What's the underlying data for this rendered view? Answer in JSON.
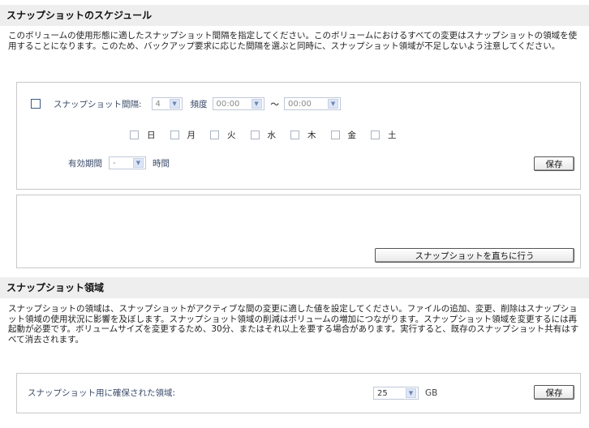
{
  "schedule": {
    "title": "スナップショットのスケジュール",
    "description": "このボリュームの使用形態に適したスナップショット間隔を指定してください。このボリュームにおけるすべての変更はスナップショットの領域を使用することになります。このため、バックアップ要求に応じた間隔を選ぶと同時に、スナップショット領域が不足しないよう注意してください。",
    "interval_label": "スナップショット間隔:",
    "interval_value": "4",
    "frequency_label": "頻度",
    "from_time": "00:00",
    "range_sep": "～",
    "to_time": "00:00",
    "days": [
      "日",
      "月",
      "火",
      "水",
      "木",
      "金",
      "土"
    ],
    "validity_label": "有効期間",
    "validity_value": "-",
    "hours_label": "時間",
    "save_label": "保存",
    "take_now_label": "スナップショットを直ちに行う"
  },
  "area": {
    "title": "スナップショット領域",
    "description": "スナップショットの領域は、スナップショットがアクティブな間の変更に適した値を設定してください。ファイルの追加、変更、削除はスナップショット領域の使用状況に影響を及ぼします。スナップショット領域の削減はボリュームの増加につながります。スナップショット領域を変更するには再起動が必要です。ボリュームサイズを変更するため、30分、またはそれ以上を要する場合があります。実行すると、既存のスナップショット共有はすべて消去されます。",
    "reserved_label": "スナップショット用に確保された領域:",
    "reserved_value": "25",
    "unit": "GB",
    "save_label": "保存"
  }
}
